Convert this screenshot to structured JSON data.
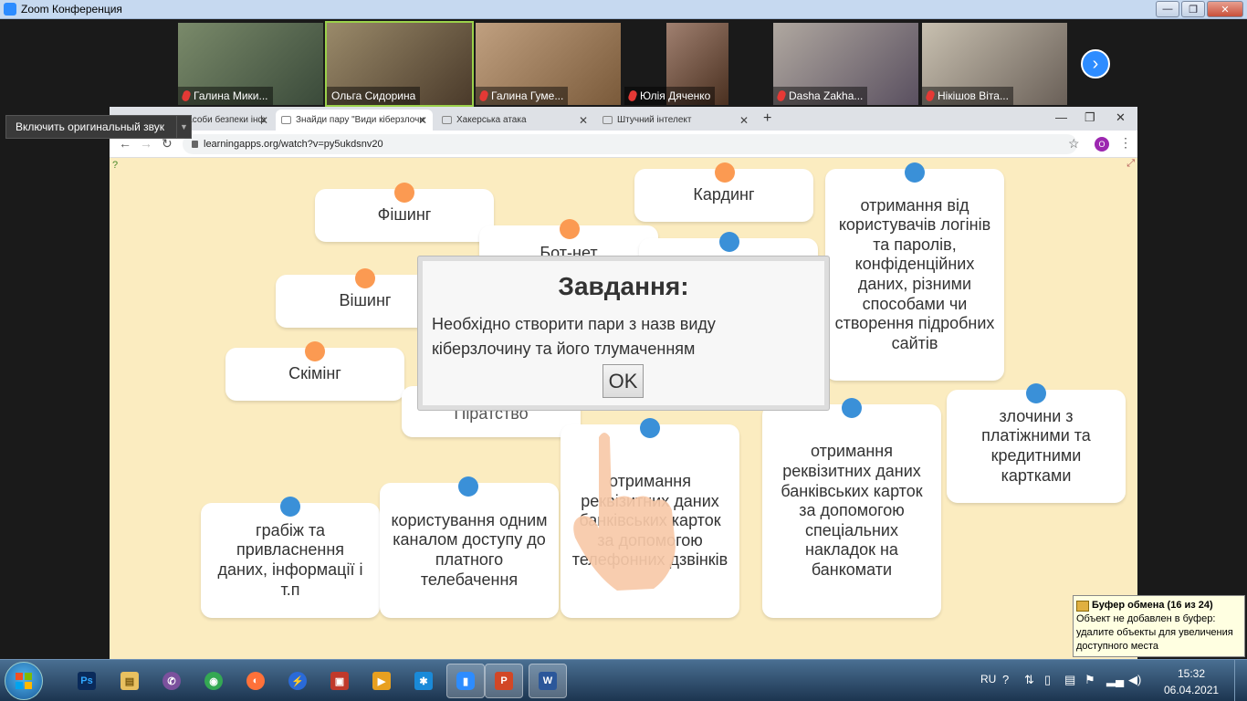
{
  "zoom": {
    "title": "Zoom Конференция",
    "win_min": "—",
    "win_max": "❐",
    "win_close": "✕"
  },
  "participants": [
    {
      "name": "Галина Мики...",
      "muted": true
    },
    {
      "name": "Ольга Сидорина",
      "muted": false
    },
    {
      "name": "Галина Гуме...",
      "muted": true
    },
    {
      "name": "Юлія Дяченко",
      "muted": true
    },
    {
      "name": "Dasha Zakha...",
      "muted": true
    },
    {
      "name": "Нікішов Віта...",
      "muted": true
    }
  ],
  "next_icon": "›",
  "tooltip": {
    "label": "Включить оригинальный звук",
    "arrow": "▼"
  },
  "browser": {
    "tabs": [
      {
        "label": "загрози та засоби безпеки інф"
      },
      {
        "label": "Знайди пару \"Види кіберзлочи"
      },
      {
        "label": "Хакерська атака"
      },
      {
        "label": "Штучний інтелект"
      }
    ],
    "tab_close": "✕",
    "new_tab": "+",
    "url": "learningapps.org/watch?v=py5ukdsnv20",
    "profile_initial": "O",
    "back": "←",
    "forward": "→",
    "reload": "↻",
    "star": "☆",
    "menu": "⋮",
    "bw_min": "—",
    "bw_max": "❐",
    "bw_close": "✕"
  },
  "app": {
    "help_icon": "?",
    "fullscreen_icon": "⤢",
    "cards": [
      {
        "text": "Фішинг",
        "dot": "orange"
      },
      {
        "text": "Бот-нет",
        "dot": "orange"
      },
      {
        "text": "Кардинг",
        "dot": "orange"
      },
      {
        "text": "",
        "dot": "blue"
      },
      {
        "text": "отримання від користувачів логінів та паролів, конфіденційних даних, різними способами чи створення підробних сайтів",
        "dot": "blue"
      },
      {
        "text": "Вішинг",
        "dot": "orange"
      },
      {
        "text": "Скімінг",
        "dot": "orange"
      },
      {
        "text": "Піратство",
        "dot": "none"
      },
      {
        "text": "отримання реквізитних даних банківських карток за допомогою телефонних дзвінків",
        "dot": "blue"
      },
      {
        "text": "отримання реквізитних даних банківських карток за допомогою спеціальних накладок на банкомати",
        "dot": "blue"
      },
      {
        "text": "злочини з платіжними та кредитними картками",
        "dot": "blue"
      },
      {
        "text": "грабіж та привласнення даних, інформації і т.п",
        "dot": "blue"
      },
      {
        "text": "користування одним каналом доступу до платного телебачення",
        "dot": "blue"
      }
    ],
    "dialog": {
      "title": "Завдання:",
      "text": "Необхідно створити пари з назв виду кіберзлочину та його тлумаченням",
      "ok": "OK"
    }
  },
  "clipboard": {
    "title": "Буфер обмена (16 из 24)",
    "text": "Объект не добавлен в буфер: удалите объекты для увеличения доступного места"
  },
  "taskbar": {
    "apps": [
      {
        "icon": "Ps",
        "color": "#0a2a5a"
      },
      {
        "icon": "▤",
        "color": "#e8c060"
      },
      {
        "icon": "✆",
        "color": "#7b519d"
      },
      {
        "icon": "◉",
        "color": "#34a853"
      },
      {
        "icon": "◐",
        "color": "#ff7139"
      },
      {
        "icon": "⚡",
        "color": "#2a6ad8"
      },
      {
        "icon": "▣",
        "color": "#c0392b"
      },
      {
        "icon": "▶",
        "color": "#e8a020"
      },
      {
        "icon": "✱",
        "color": "#1a8ad8"
      },
      {
        "icon": "▮",
        "color": "#2d8cff"
      },
      {
        "icon": "P",
        "color": "#d24726"
      },
      {
        "icon": "W",
        "color": "#2b579a"
      }
    ],
    "lang": "RU",
    "time": "15:32",
    "date": "06.04.2021"
  }
}
